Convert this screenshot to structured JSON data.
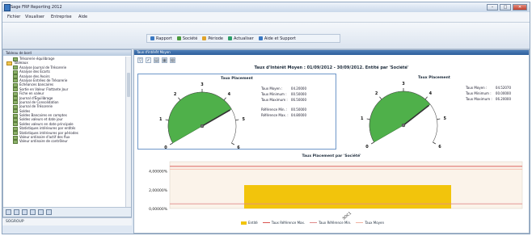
{
  "window": {
    "title": "Sage FRP Reporting 2012",
    "buttons": [
      "–",
      "□",
      "✕"
    ]
  },
  "menu": {
    "items": [
      "Fichier",
      "Visualiser",
      "Entreprise",
      "Aide"
    ]
  },
  "toolbar": {
    "items": [
      {
        "label": "Rapport",
        "icon": "report-icon",
        "color": "#3a78c2"
      },
      {
        "label": "Société",
        "icon": "company-icon",
        "color": "#4c9a3e"
      },
      {
        "label": "Période",
        "icon": "period-icon",
        "color": "#e0a32a"
      },
      {
        "label": "Actualiser",
        "icon": "refresh-icon",
        "color": "#2f9e6a"
      },
      {
        "label": "Aide et Support",
        "icon": "help-icon",
        "color": "#3a78c2"
      }
    ]
  },
  "sidebar": {
    "header": "Tableau de bord",
    "tree": [
      {
        "label": "Trésorerie équilibrage",
        "kind": "leaf",
        "indent": 1
      },
      {
        "label": "Tableaux",
        "kind": "folder",
        "indent": 0
      },
      {
        "label": "Analyse Journal de Trésorerie",
        "kind": "leaf",
        "indent": 1
      },
      {
        "label": "Analyse des Écarts",
        "kind": "leaf",
        "indent": 1
      },
      {
        "label": "Analyse des Avoirs",
        "kind": "leaf",
        "indent": 1
      },
      {
        "label": "Analyse Entrées de Trésorerie",
        "kind": "leaf",
        "indent": 1
      },
      {
        "label": "Échéances bancaires",
        "kind": "leaf",
        "indent": 1
      },
      {
        "label": "Sortie en Valeur Flottante Jour",
        "kind": "leaf",
        "indent": 1
      },
      {
        "label": "Fiche en valeur",
        "kind": "leaf",
        "indent": 1
      },
      {
        "label": "Journal d'Équilibrage",
        "kind": "leaf",
        "indent": 1
      },
      {
        "label": "Journal de Consolidation",
        "kind": "leaf",
        "indent": 1
      },
      {
        "label": "Journal de Trésorerie",
        "kind": "leaf",
        "indent": 1
      },
      {
        "label": "Soldes",
        "kind": "leaf",
        "indent": 1
      },
      {
        "label": "Soldes Bancaires en comptes",
        "kind": "leaf",
        "indent": 1
      },
      {
        "label": "Soldes valeurs et date jour",
        "kind": "leaf",
        "indent": 1
      },
      {
        "label": "Soldes valeurs en date principale",
        "kind": "leaf",
        "indent": 1
      },
      {
        "label": "Statistiques intérieures par entités",
        "kind": "leaf",
        "indent": 1
      },
      {
        "label": "Statistiques intérieures par périodes",
        "kind": "leaf",
        "indent": 1
      },
      {
        "label": "Valeur ordinaire d'actif des flux",
        "kind": "leaf",
        "indent": 1
      },
      {
        "label": "Valeur ordinaire de contrôleur",
        "kind": "leaf",
        "indent": 1
      }
    ],
    "status": "SOGROUP"
  },
  "main": {
    "header": "Taux d'intérêt Moyen",
    "title": "Taux d'Intérêt Moyen : 01/09/2012 - 30/09/2012. Entité par 'Société'",
    "gauges": [
      {
        "title": "Taux Placement",
        "value": 4.5,
        "ticks": [
          "0",
          "1",
          "2",
          "3",
          "4",
          "5",
          "6"
        ],
        "stats": [
          {
            "label": "Taux Moyen :",
            "value": "04.20000"
          },
          {
            "label": "Taux Minimum :",
            "value": "00.50000"
          },
          {
            "label": "Taux Maximum :",
            "value": "06.50000"
          },
          {
            "label": "Référence Min. :",
            "value": "00.50000"
          },
          {
            "label": "Référence Max. :",
            "value": "04.80000"
          }
        ]
      },
      {
        "title": "Taux Placement",
        "value": 4.3,
        "ticks": [
          "0",
          "1",
          "2",
          "3",
          "4",
          "5",
          "6"
        ],
        "stats": [
          {
            "label": "Taux Moyen :",
            "value": "04.52070"
          },
          {
            "label": "Taux Minimum :",
            "value": "00.00000"
          },
          {
            "label": "Taux Maximum :",
            "value": "06.20000"
          }
        ]
      }
    ]
  },
  "chart_data": {
    "type": "bar",
    "title": "Taux Placement par 'Société'",
    "categories": [
      "SOC1"
    ],
    "series": [
      {
        "name": "Entité",
        "values": [
          2.5
        ],
        "color": "#f2c40c"
      },
      {
        "name": "Taux Référence Max.",
        "values": [
          4.5
        ],
        "color": "#d9534f"
      },
      {
        "name": "Taux Référence Min.",
        "values": [
          0.5
        ],
        "color": "#e08a8a"
      },
      {
        "name": "Taux Moyen",
        "values": [
          4.2
        ],
        "color": "#f0b2a0"
      }
    ],
    "ytick_labels": [
      "4,00000%",
      "2,00000%",
      "0,00000%"
    ],
    "ylim": [
      0,
      5
    ],
    "grid": false,
    "legend": "bottom"
  }
}
